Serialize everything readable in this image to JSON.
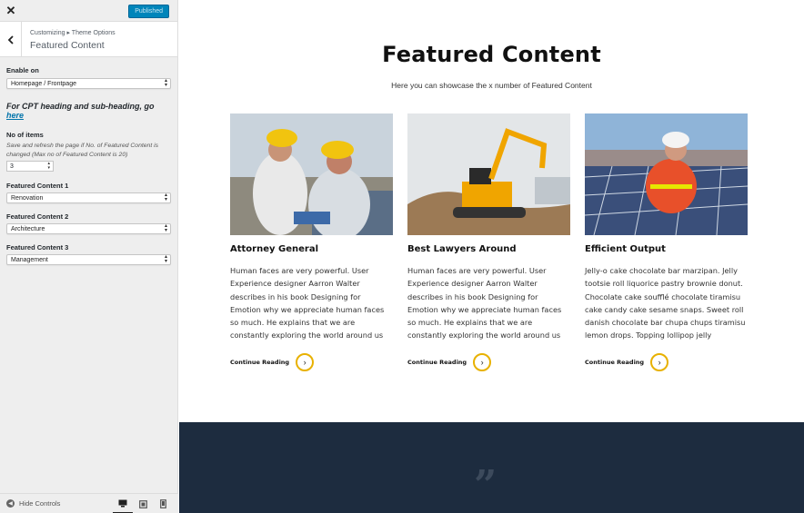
{
  "customizer": {
    "header": {
      "close_icon": "close-icon",
      "publish_label": "Published"
    },
    "section": {
      "breadcrumb": "Customizing ▸ Theme Options",
      "title": "Featured Content"
    },
    "controls": {
      "enable_on": {
        "label": "Enable on",
        "value": "Homepage / Frontpage"
      },
      "cpt_note_prefix": "For CPT heading and sub-heading, go ",
      "cpt_note_link": "here",
      "num_items": {
        "label": "No of items",
        "description": "Save and refresh the page if No. of Featured Content is changed (Max no of Featured Content is 20)",
        "value": "3"
      },
      "featured_1": {
        "label": "Featured Content 1",
        "value": "Renovation"
      },
      "featured_2": {
        "label": "Featured Content 2",
        "value": "Architecture"
      },
      "featured_3": {
        "label": "Featured Content 3",
        "value": "Management"
      }
    },
    "footer": {
      "hide_controls_label": "Hide Controls",
      "devices": [
        "desktop-icon",
        "tablet-icon",
        "mobile-icon"
      ]
    }
  },
  "preview": {
    "title": "Featured Content",
    "subtitle": "Here you can showcase the x number of Featured Content",
    "cards": [
      {
        "title": "Attorney General",
        "text": "Human faces are very powerful. User Experience designer Aarron Walter describes in his book Designing for Emotion why we appreciate human faces so much. He explains that we are constantly exploring the world around us",
        "cta": "Continue Reading"
      },
      {
        "title": "Best Lawyers Around",
        "text": "Human faces are very powerful. User Experience designer Aarron Walter describes in his book Designing for Emotion why we appreciate human faces so much. He explains that we are constantly exploring the world around us",
        "cta": "Continue Reading"
      },
      {
        "title": "Efficient Output",
        "text": "Jelly-o cake chocolate bar marzipan. Jelly tootsie roll liquorice pastry brownie donut. Chocolate cake soufflé chocolate tiramisu cake candy cake sesame snaps. Sweet roll danish chocolate bar chupa chups tiramisu lemon drops. Topping lollipop jelly",
        "cta": "Continue Reading"
      }
    ],
    "quote_glyph": "”"
  },
  "colors": {
    "publish_blue": "#0085ba",
    "link_blue": "#0073aa",
    "accent_yellow": "#e8b100",
    "dark_band": "#1d2c3f"
  }
}
